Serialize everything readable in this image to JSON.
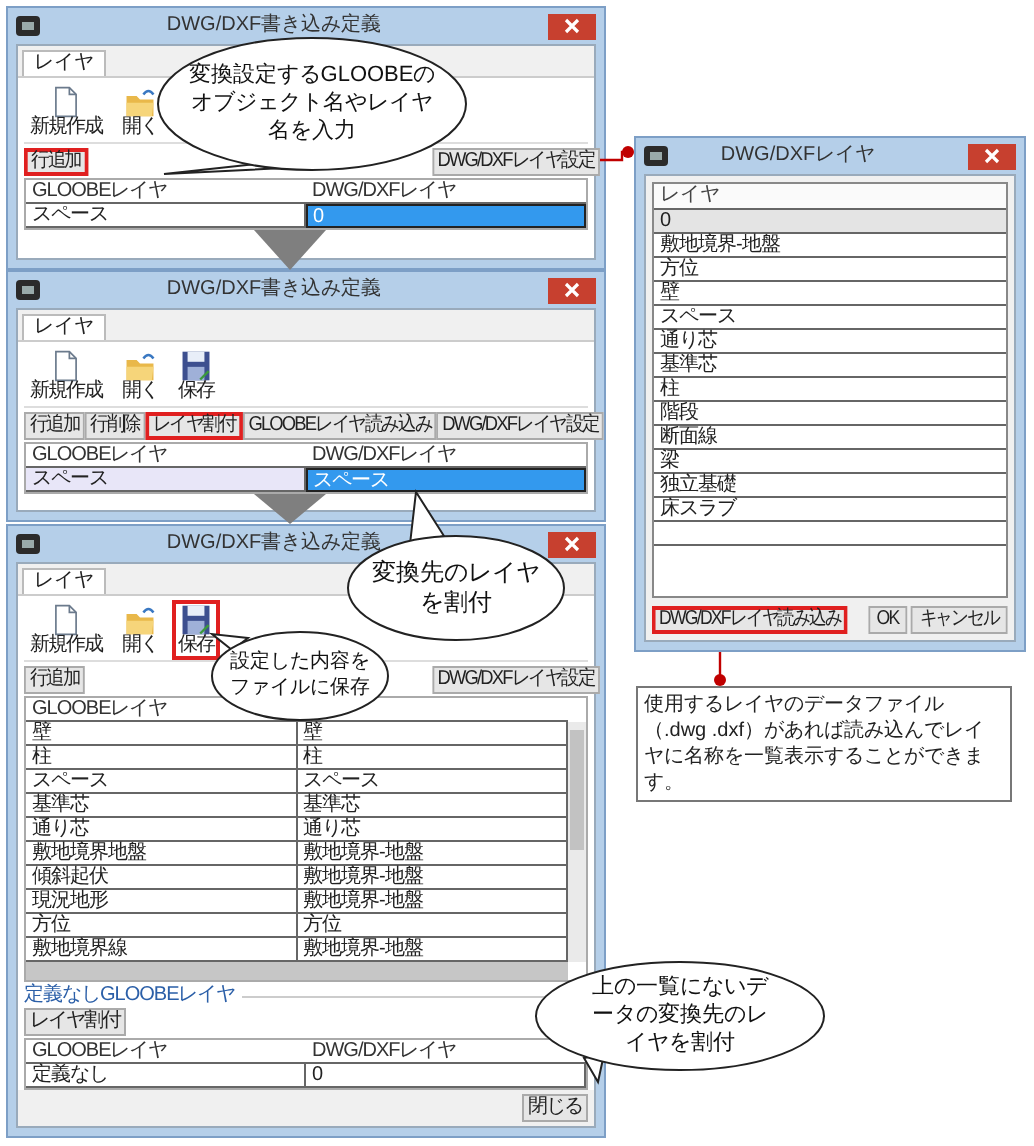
{
  "windows": [
    {
      "title": "DWG/DXF書き込み定義",
      "tab": {
        "label": "レイヤ",
        "selected": true
      },
      "tools": [
        {
          "kind": "new",
          "label": "新規作成",
          "highlighted": false
        },
        {
          "kind": "open",
          "label": "開く",
          "highlighted": false
        }
      ],
      "left_buttons": [
        {
          "label": "行追加",
          "highlighted": true
        }
      ],
      "right_buttons": [
        {
          "label": "DWG/DXFレイヤ設定",
          "highlighted": false
        }
      ],
      "table": {
        "columns": [
          "GLOOBEレイヤ",
          "DWG/DXFレイヤ"
        ],
        "rows": [
          {
            "selected": false,
            "cells": [
              {
                "text": "スペース",
                "selected": false
              },
              {
                "text": "0",
                "selected": true
              }
            ]
          }
        ]
      }
    },
    {
      "title": "DWG/DXF書き込み定義",
      "tab": {
        "label": "レイヤ",
        "selected": true
      },
      "tools": [
        {
          "kind": "new",
          "label": "新規作成",
          "highlighted": false
        },
        {
          "kind": "open",
          "label": "開く",
          "highlighted": false
        },
        {
          "kind": "save",
          "label": "保存",
          "highlighted": false
        }
      ],
      "left_buttons": [
        {
          "label": "行追加",
          "highlighted": false
        },
        {
          "label": "行削除",
          "highlighted": false
        },
        {
          "label": "レイヤ割付",
          "highlighted": true
        }
      ],
      "right_buttons": [
        {
          "label": "GLOOBEレイヤ読み込み",
          "highlighted": false
        },
        {
          "label": "DWG/DXFレイヤ設定",
          "highlighted": false
        }
      ],
      "table": {
        "columns": [
          "GLOOBEレイヤ",
          "DWG/DXFレイヤ"
        ],
        "rows": [
          {
            "selected": true,
            "cells": [
              {
                "text": "スペース",
                "selected": false
              },
              {
                "text": "スペース",
                "selected": true
              }
            ]
          }
        ]
      }
    },
    {
      "title": "DWG/DXF書き込み定義",
      "tab": {
        "label": "レイヤ",
        "selected": true
      },
      "tools": [
        {
          "kind": "new",
          "label": "新規作成",
          "highlighted": false
        },
        {
          "kind": "open",
          "label": "開く",
          "highlighted": false
        },
        {
          "kind": "save",
          "label": "保存",
          "highlighted": true
        }
      ],
      "left_buttons": [
        {
          "label": "行追加",
          "highlighted": false
        }
      ],
      "right_buttons": [
        {
          "label": "DWG/DXFレイヤ設定",
          "highlighted": false
        }
      ],
      "table": {
        "scrollable": true,
        "columns": [
          "GLOOBEレイヤ"
        ],
        "rows": [
          {
            "selected": false,
            "cells": [
              {
                "text": "壁",
                "selected": false
              },
              {
                "text": "壁",
                "selected": false
              }
            ]
          },
          {
            "selected": false,
            "cells": [
              {
                "text": "柱",
                "selected": false
              },
              {
                "text": "柱",
                "selected": false
              }
            ]
          },
          {
            "selected": false,
            "cells": [
              {
                "text": "スペース",
                "selected": false
              },
              {
                "text": "スペース",
                "selected": false
              }
            ]
          },
          {
            "selected": false,
            "cells": [
              {
                "text": "基準芯",
                "selected": false
              },
              {
                "text": "基準芯",
                "selected": false
              }
            ]
          },
          {
            "selected": false,
            "cells": [
              {
                "text": "通り芯",
                "selected": false
              },
              {
                "text": "通り芯",
                "selected": false
              }
            ]
          },
          {
            "selected": false,
            "cells": [
              {
                "text": "敷地境界地盤",
                "selected": false
              },
              {
                "text": "敷地境界-地盤",
                "selected": false
              }
            ]
          },
          {
            "selected": false,
            "cells": [
              {
                "text": "傾斜起伏",
                "selected": false
              },
              {
                "text": "敷地境界-地盤",
                "selected": false
              }
            ]
          },
          {
            "selected": false,
            "cells": [
              {
                "text": "現況地形",
                "selected": false
              },
              {
                "text": "敷地境界-地盤",
                "selected": false
              }
            ]
          },
          {
            "selected": false,
            "cells": [
              {
                "text": "方位",
                "selected": false
              },
              {
                "text": "方位",
                "selected": false
              }
            ]
          },
          {
            "selected": false,
            "cells": [
              {
                "text": "敷地境界線",
                "selected": false
              },
              {
                "text": "敷地境界-地盤",
                "selected": false
              }
            ]
          }
        ]
      },
      "undefined_section": {
        "label": "定義なしGLOOBEレイヤ",
        "button": {
          "label": "レイヤ割付",
          "highlighted": false
        },
        "table": {
          "columns": [
            "GLOOBEレイヤ",
            "DWG/DXFレイヤ"
          ],
          "rows": [
            {
              "selected": false,
              "cells": [
                {
                  "text": "定義なし",
                  "selected": false
                },
                {
                  "text": "0",
                  "selected": false
                }
              ]
            }
          ]
        }
      },
      "footer_button": "閉じる"
    }
  ],
  "layer_dialog": {
    "title": "DWG/DXFレイヤ",
    "column": "レイヤ",
    "items": [
      {
        "label": "0",
        "selected": true
      },
      {
        "label": "敷地境界-地盤",
        "selected": false
      },
      {
        "label": "方位",
        "selected": false
      },
      {
        "label": "壁",
        "selected": false
      },
      {
        "label": "スペース",
        "selected": false
      },
      {
        "label": "通り芯",
        "selected": false
      },
      {
        "label": "基準芯",
        "selected": false
      },
      {
        "label": "柱",
        "selected": false
      },
      {
        "label": "階段",
        "selected": false
      },
      {
        "label": "断面線",
        "selected": false
      },
      {
        "label": "梁",
        "selected": false
      },
      {
        "label": "独立基礎",
        "selected": false
      },
      {
        "label": "床スラブ",
        "selected": false
      }
    ],
    "buttons": [
      {
        "label": "DWG/DXFレイヤ読み込み",
        "highlighted": true
      },
      {
        "label": "OK",
        "highlighted": false
      },
      {
        "label": "キャンセル",
        "highlighted": false
      }
    ]
  },
  "note": "使用するレイヤのデータファイル（.dwg .dxf）があれば読み込んでレイヤに名称を一覧表示することができます。",
  "callouts": [
    "変換設定するGLOOBEのオブジェクト名やレイヤ名を入力",
    "変換先のレイヤを割付",
    "設定した内容をファイルに保存",
    "上の一覧にないデータの変換先のレイヤを割付"
  ]
}
